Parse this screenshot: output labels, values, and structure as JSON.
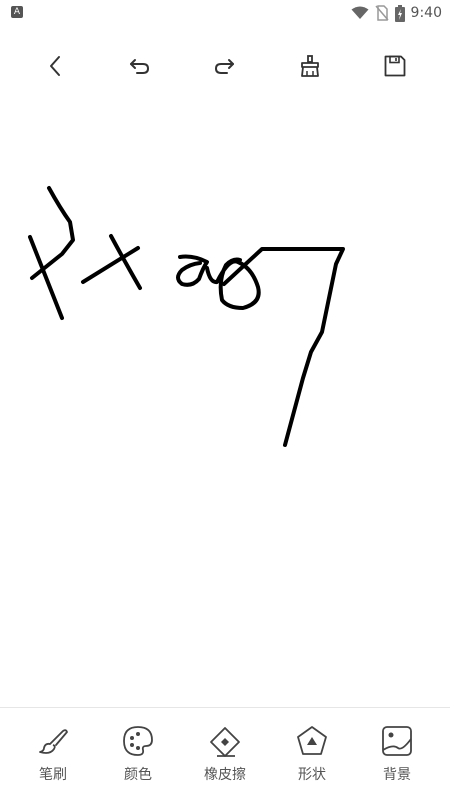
{
  "status_bar": {
    "time": "9:40"
  },
  "toolbar": {
    "buttons": [
      "back",
      "undo",
      "redo",
      "clear",
      "save"
    ]
  },
  "bottom_bar": {
    "tools": [
      {
        "label": "笔刷",
        "icon": "brush-icon"
      },
      {
        "label": "颜色",
        "icon": "palette-icon"
      },
      {
        "label": "橡皮擦",
        "icon": "eraser-icon"
      },
      {
        "label": "形状",
        "icon": "shape-icon"
      },
      {
        "label": "背景",
        "icon": "background-icon"
      }
    ]
  },
  "canvas": {
    "stroke_color": "#000000"
  }
}
